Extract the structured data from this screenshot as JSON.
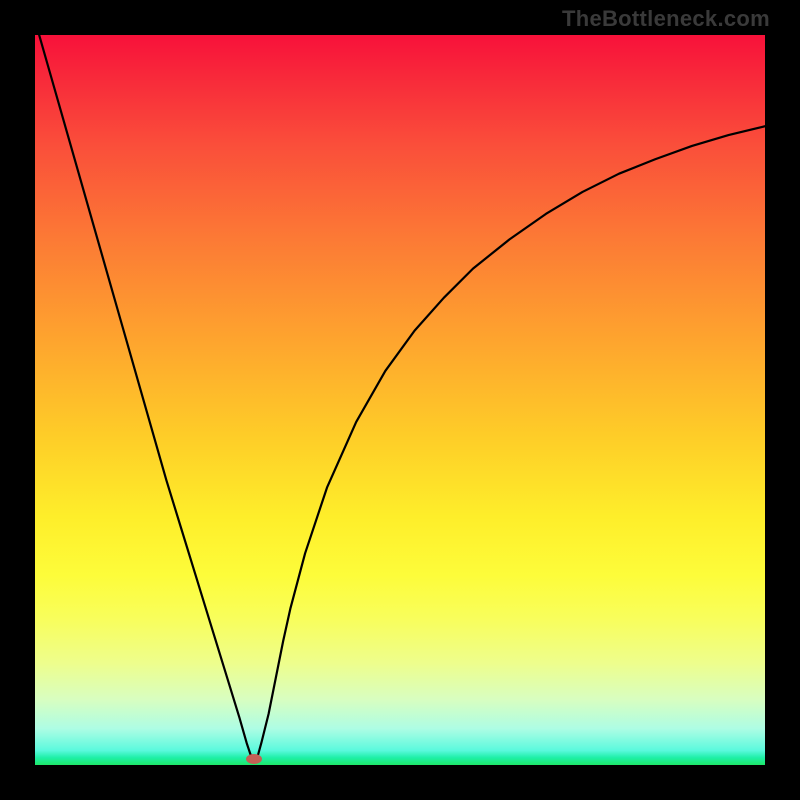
{
  "watermark": "TheBottleneck.com",
  "chart_data": {
    "type": "line",
    "title": "",
    "xlabel": "",
    "ylabel": "",
    "xlim": [
      0,
      100
    ],
    "ylim": [
      0,
      100
    ],
    "x": [
      0,
      2,
      4,
      6,
      8,
      10,
      12,
      14,
      16,
      18,
      20,
      22,
      24,
      26,
      28,
      29,
      29.5,
      30,
      30.5,
      31,
      32,
      33,
      34,
      35,
      37,
      40,
      44,
      48,
      52,
      56,
      60,
      65,
      70,
      75,
      80,
      85,
      90,
      95,
      100
    ],
    "values": [
      102,
      95,
      88,
      81,
      74,
      67,
      60,
      53,
      46,
      39,
      32.5,
      26,
      19.5,
      13,
      6.5,
      3,
      1.5,
      0.5,
      1.2,
      3,
      7,
      12,
      17,
      21.5,
      29,
      38,
      47,
      54,
      59.5,
      64,
      68,
      72,
      75.5,
      78.5,
      81,
      83,
      84.8,
      86.3,
      87.5
    ],
    "annotations": [
      {
        "type": "dot",
        "x": 30,
        "y": 0.8,
        "color": "#c46055"
      }
    ],
    "background": {
      "type": "vertical_gradient",
      "stops": [
        {
          "pos": 0,
          "color": "#f8113a"
        },
        {
          "pos": 50,
          "color": "#fecd28"
        },
        {
          "pos": 100,
          "color": "#1ee869"
        }
      ]
    }
  },
  "dot": {
    "left_pct": 30,
    "top_pct": 99.2
  }
}
